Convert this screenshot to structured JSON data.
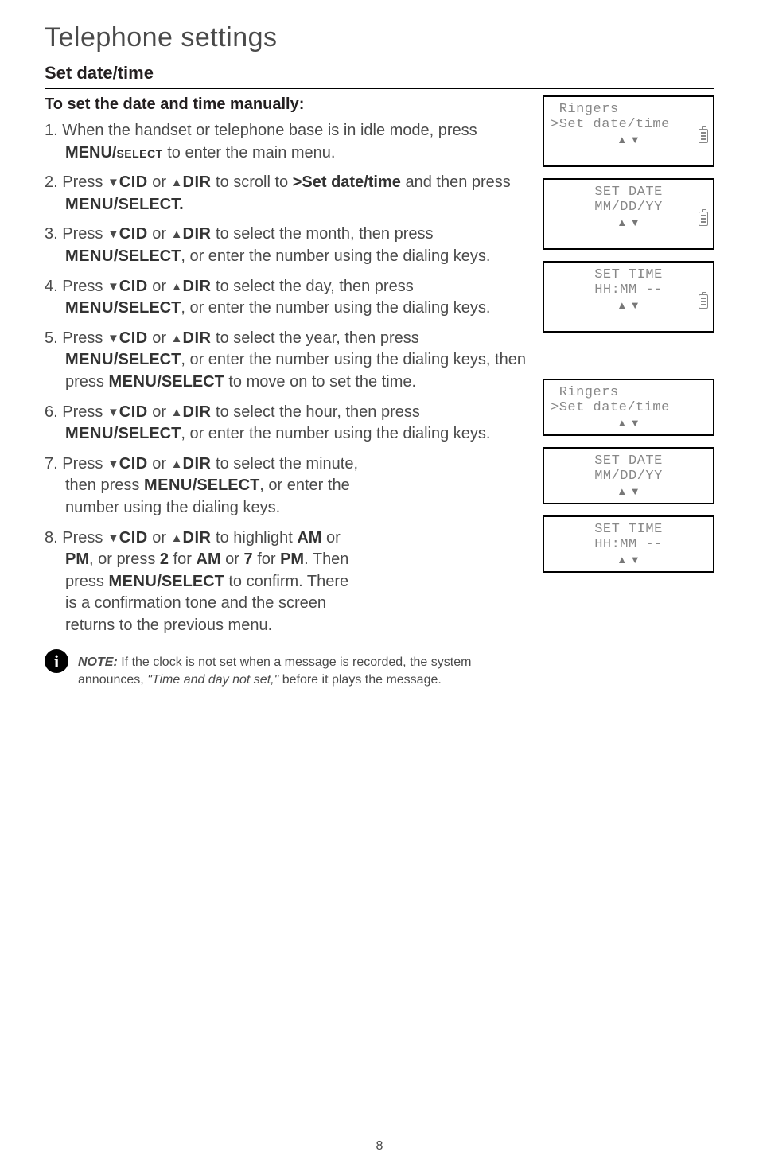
{
  "title": "Telephone settings",
  "section": "Set date/time",
  "subheading": "To set the date and time manually:",
  "steps": [
    {
      "num": "1.",
      "pre": "When the handset or telephone base is in idle mode, press ",
      "key": "MENU/",
      "sc": "select",
      "post": " to enter the main menu."
    },
    {
      "num": "2.",
      "pre": "Press ",
      "btn1": "▼",
      "sc1": "CID",
      "mid": " or ",
      "btn2": "▲",
      "sc2": "DIR",
      "after": " to scroll to ",
      "target": ">Set date/time",
      "tail": " and then press ",
      "menu": "MENU",
      "sel": "/SELECT."
    },
    {
      "num": "3.",
      "pre": "Press ",
      "btn1": "▼",
      "sc1": "CID",
      "mid": " or ",
      "btn2": "▲",
      "sc2": "DIR",
      "after": " to select the month, then press ",
      "menu": "MENU",
      "sel": "/SELECT",
      "tail2": ", or enter the number using the dialing keys."
    },
    {
      "num": "4.",
      "pre": "Press ",
      "btn1": "▼",
      "sc1": "CID",
      "mid": " or ",
      "btn2": "▲",
      "sc2": "DIR",
      "after": " to select the day, then press ",
      "menu": "MENU",
      "sel": "/SELECT",
      "tail2": ", or enter the number using the dialing keys."
    },
    {
      "num": "5.",
      "pre": "Press ",
      "btn1": "▼",
      "sc1": "CID",
      "mid": " or ",
      "btn2": "▲",
      "sc2": "DIR",
      "after": " to select the year, then press ",
      "menu": "MENU",
      "sel": "/SELECT",
      "tail2": ", or enter the number using the dialing keys, then press ",
      "menu2": "MENU",
      "sel2": "/SELECT",
      "tail3": " to move on to set the time."
    },
    {
      "num": "6.",
      "pre": "Press ",
      "btn1": "▼",
      "sc1": "CID",
      "mid": " or ",
      "btn2": "▲",
      "sc2": "DIR",
      "after": " to select the hour, then press ",
      "menu": "MENU",
      "sel": "/SELECT",
      "tail2": ", or enter the number using the dialing keys."
    },
    {
      "num": "7.",
      "pre": "Press ",
      "btn1": "▼",
      "sc1": "CID",
      "mid": " or ",
      "btn2": "▲",
      "sc2": "DIR",
      "after": " to select the minute, then press ",
      "menu": "MENU",
      "sel": "/SELECT",
      "tail2": ", or enter the number using the dialing keys."
    },
    {
      "num": "8.",
      "pre": "Press ",
      "btn1": "▼",
      "sc1": "CID",
      "mid": " or ",
      "btn2": "▲",
      "sc2": "DIR",
      "after": " to highlight ",
      "am": "AM",
      "or": " or ",
      "pm": "PM",
      "afterpm": ", or press ",
      "two": "2",
      "forr": " for ",
      "am2": "AM",
      "or2": " or ",
      "seven": "7",
      "for2": " for ",
      "pm2": "PM",
      "then": ". Then press ",
      "menu": "MENU",
      "sel": "/SELECT",
      "confirm": " to confirm. There is a confirmation tone and the screen returns to the previous menu."
    }
  ],
  "note": {
    "label": "NOTE:",
    "text1": " If the clock is not set when a message is recorded, the system announces, ",
    "quote": "\"Time and day not set,\"",
    "text2": " before it plays the message."
  },
  "lcd": {
    "b1l1": " Ringers",
    "b1l2": ">Set date/time",
    "b2l1": "SET DATE",
    "b2l2": "MM/DD/YY",
    "b3l1": "SET TIME",
    "b3l2": "HH:MM --",
    "b4l1": " Ringers",
    "b4l2": ">Set date/time",
    "b5l1": "SET DATE",
    "b5l2": "MM/DD/YY",
    "b6l1": "SET TIME",
    "b6l2": "HH:MM --",
    "arrows": "▲\n▼"
  },
  "pageNumber": "8"
}
